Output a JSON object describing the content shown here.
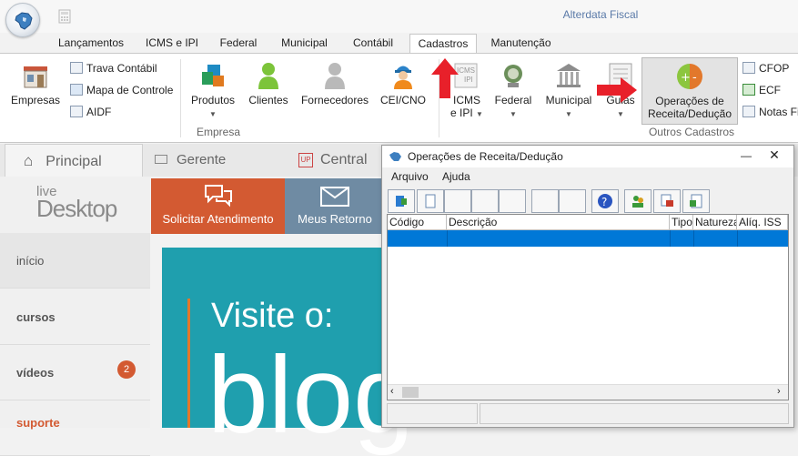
{
  "app": {
    "title": "Alterdata Fiscal"
  },
  "ribbon_tabs": [
    "Lançamentos",
    "ICMS e IPI",
    "Federal",
    "Municipal",
    "Contábil",
    "Cadastros",
    "Manutenção"
  ],
  "ribbon": {
    "empresas": "Empresas",
    "trava_contabil": "Trava Contábil",
    "mapa_controle": "Mapa de Controle",
    "aidf": "AIDF",
    "produtos": "Produtos",
    "clientes": "Clientes",
    "fornecedores": "Fornecedores",
    "cei_cno": "CEI/CNO",
    "icms_ipi_line1": "ICMS",
    "icms_ipi_line2": "e IPI",
    "federal": "Federal",
    "municipal": "Municipal",
    "guias": "Guias",
    "operacoes_line1": "Operações de",
    "operacoes_line2": "Receita/Dedução",
    "cfop": "CFOP",
    "ecf": "ECF",
    "notas_fiscais": "Notas Fi",
    "group_empresa": "Empresa",
    "group_outros": "Outros Cadastros",
    "icms_badge": "ICMS",
    "ipi_badge": "IPI"
  },
  "content_tabs": {
    "principal": "Principal",
    "gerente": "Gerente Eletrônico",
    "central": "Central Pac",
    "up_badge": "UP"
  },
  "sidebar": {
    "logo_top": "live",
    "logo_bottom": "Desktop",
    "items": [
      "início",
      "cursos",
      "vídeos",
      "suporte"
    ],
    "videos_badge": "2"
  },
  "tiles": {
    "solicitar": "Solicitar Atendimento",
    "retornos": "Meus Retorno"
  },
  "banner": {
    "text1": "Visite o:",
    "text2": "blog"
  },
  "dialog": {
    "title": "Operações de Receita/Dedução",
    "menu": [
      "Arquivo",
      "Ajuda"
    ],
    "columns": [
      "Código",
      "Descrição",
      "Tipo",
      "Natureza",
      "Alíq. ISS"
    ]
  },
  "colors": {
    "accent_orange": "#d35a32",
    "selection_blue": "#0078d7",
    "banner_teal": "#1f9fae",
    "arrow_red": "#e8202a"
  }
}
